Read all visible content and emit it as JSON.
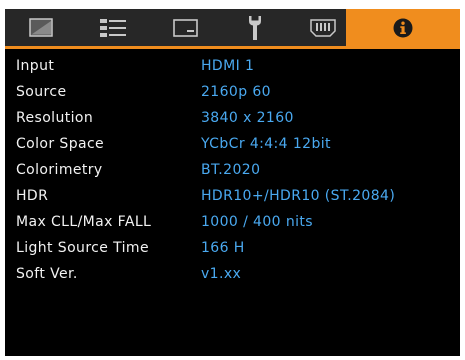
{
  "tabs": [
    {
      "icon": "picture-icon",
      "active": false
    },
    {
      "icon": "settings-list-icon",
      "active": false
    },
    {
      "icon": "display-icon",
      "active": false
    },
    {
      "icon": "wrench-icon",
      "active": false
    },
    {
      "icon": "connector-icon",
      "active": false
    },
    {
      "icon": "info-icon",
      "active": true
    }
  ],
  "colors": {
    "accent": "#f08d1e",
    "tab_bar": "#272727",
    "background": "#000000",
    "label_text": "#f2f2f2",
    "value_text": "#4aa9f0"
  },
  "info_rows": [
    {
      "label": "Input",
      "value": "HDMI 1"
    },
    {
      "label": "Source",
      "value": "2160p 60"
    },
    {
      "label": "Resolution",
      "value": "3840 x 2160"
    },
    {
      "label": "Color Space",
      "value": "YCbCr 4:4:4 12bit"
    },
    {
      "label": "Colorimetry",
      "value": "BT.2020"
    },
    {
      "label": "HDR",
      "value": "HDR10+/HDR10 (ST.2084)"
    },
    {
      "label": "Max CLL/Max FALL",
      "value": "1000 / 400 nits"
    },
    {
      "label": "Light Source Time",
      "value": "166 H"
    },
    {
      "label": "Soft Ver.",
      "value": "v1.xx"
    }
  ]
}
